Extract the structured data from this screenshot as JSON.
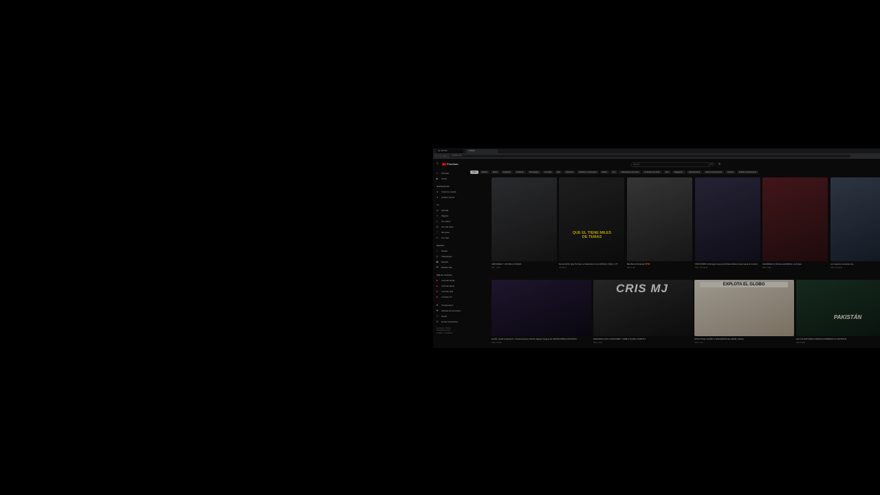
{
  "browser": {
    "tabs": [
      "(1) YouTube",
      "YouTube"
    ],
    "url": "youtube.com"
  },
  "header": {
    "logo_text": "Premium",
    "search_placeholder": "Buscar"
  },
  "chips": [
    "Todo",
    "Música",
    "Mixes",
    "Reguetón",
    "Podcasts",
    "Videojuegos",
    "Comedia",
    "Rap",
    "Pokémon",
    "Pasteles y merengues",
    "Bollos",
    "Arte",
    "Videojuegos de acción",
    "Productos de estilo",
    "Jazz",
    "Reggaetón",
    "Latinoamérica",
    "Vistos recientemente",
    "Nuevos",
    "Subido recientemente"
  ],
  "sidebar": {
    "main": [
      {
        "icon": "home-icon",
        "glyph": "⌂",
        "label": "Principal"
      },
      {
        "icon": "shorts-icon",
        "glyph": "▶",
        "label": "Shorts"
      }
    ],
    "subs_title": "Suscripciones",
    "subs": [
      {
        "label": "Canal de Loquillo"
      },
      {
        "label": "creativo central"
      }
    ],
    "you_title": "Tú",
    "you": [
      {
        "glyph": "◷",
        "label": "Historial"
      },
      {
        "glyph": "≡",
        "label": "Playlists"
      },
      {
        "glyph": "▷",
        "label": "Tus videos"
      },
      {
        "glyph": "◴",
        "label": "Ver más tarde"
      },
      {
        "glyph": "♡",
        "label": "Me gusta"
      },
      {
        "glyph": "✂",
        "label": "Tus clips"
      }
    ],
    "explore_title": "Explorar",
    "explore": [
      {
        "glyph": "♪",
        "label": "Música"
      },
      {
        "glyph": "◎",
        "label": "Videojuegos"
      },
      {
        "glyph": "▦",
        "label": "Noticias"
      },
      {
        "glyph": "☰",
        "label": "Mostrar más"
      }
    ],
    "more_title": "Más de YouTube",
    "more": [
      {
        "label": "YouTube Studio"
      },
      {
        "label": "YouTube Music"
      },
      {
        "label": "YouTube Kids"
      },
      {
        "label": "YouTube TV"
      }
    ],
    "settings": [
      {
        "glyph": "⚙",
        "label": "Configuración"
      },
      {
        "glyph": "⚑",
        "label": "Historial de denuncias"
      },
      {
        "glyph": "?",
        "label": "Ayuda"
      },
      {
        "glyph": "✉",
        "label": "Enviar comentarios"
      }
    ],
    "footer": [
      "Acerca de · Prensa",
      "Derechos de autor",
      "Contacto · Creadores"
    ]
  },
  "row1": [
    {
      "title": "ARCÁNGEL Y LOS DE LA NUEVA",
      "meta": "Hoy · 1 año",
      "overlay": "",
      "colors": [
        "#3b3c40",
        "#1a1a1a"
      ]
    },
    {
      "title": "Me Ha Dicho Que Por Eso Lo Desterraron Con El Botón | Parte 1 VT",
      "meta": "Ver ahora",
      "overlay": "QUE EL TIENE MILES DE TEMAS",
      "colors": [
        "#2a2a2a",
        "#111"
      ]
    },
    {
      "title": "Bad Bunny Rodeado ❤️❤️",
      "meta": "Hace 1 día",
      "overlay": "",
      "colors": [
        "#4a4a4a",
        "#1f1f1f"
      ]
    },
    {
      "title": "PDF ÍNTIMO 😮 Elmaya mayores El Mamá Mama mayor pasa al momento de Ventilar",
      "meta": "Hace 3 semanas",
      "overlay": "",
      "colors": [
        "#35304a",
        "#151322"
      ]
    },
    {
      "title": "AGÁRRALE 😮 Dónde está Bubba y la Amiga",
      "meta": "Hace 2 días",
      "overlay": "",
      "colors": [
        "#5b1f24",
        "#2b0f12"
      ]
    },
    {
      "title": "Los mejores momentos de...",
      "meta": "Hace 1 semana",
      "overlay": "",
      "colors": [
        "#3e4a5a",
        "#1a2230"
      ]
    }
  ],
  "row2": [
    {
      "title": "El Alfa, Jowell & Randy Ft. | Tiraera Nueva | Shizzle Rapper Trapper EL INDISCUTIBLE CONTINÚA",
      "meta": "Hace 2 horas",
      "overlay": "",
      "colors": [
        "#2b1e3f",
        "#0d0a16"
      ]
    },
    {
      "title": "DESCARGA SUS CANCIONES Y HABLA CLARO | PARTE 2",
      "meta": "Hace 4 días",
      "overlay": "CRIS MJ",
      "colors": [
        "#333",
        "#111"
      ]
    },
    {
      "title": "EXPLOTA EL GLOBO O ENCUENTRA EL AMOR | Misión",
      "meta": "Hace 1 mes",
      "overlay": "EXPLOTA EL GLOBO",
      "colors": [
        "#d9d2c4",
        "#a89a86"
      ]
    },
    {
      "title": "HAY UN RAP PARA COMUNAS MIDIENDO AL PAKISTÁN",
      "meta": "Hace 6 días",
      "overlay": "PAKISTÁN",
      "colors": [
        "#1f3a2a",
        "#0c1a12"
      ]
    }
  ]
}
